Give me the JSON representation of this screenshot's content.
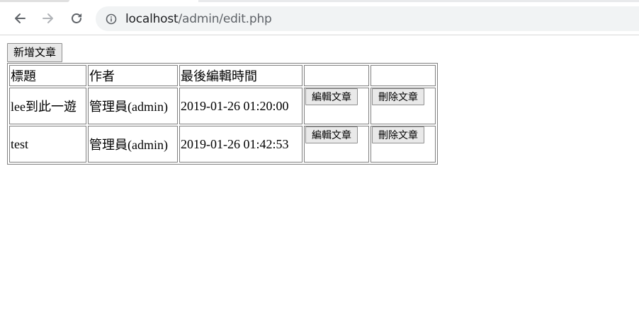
{
  "browser": {
    "url_host": "localhost",
    "url_path": "/admin/edit.php"
  },
  "page": {
    "new_post_label": "新增文章",
    "table": {
      "headers": [
        "標題",
        "作者",
        "最後編輯時間",
        "",
        ""
      ],
      "rows": [
        {
          "title": "lee到此一遊",
          "author": "管理員(admin)",
          "updated": "2019-01-26 01:20:00",
          "edit_label": "編輯文章",
          "delete_label": "刪除文章"
        },
        {
          "title": "test",
          "author": "管理員(admin)",
          "updated": "2019-01-26 01:42:53",
          "edit_label": "編輯文章",
          "delete_label": "刪除文章"
        }
      ]
    }
  }
}
